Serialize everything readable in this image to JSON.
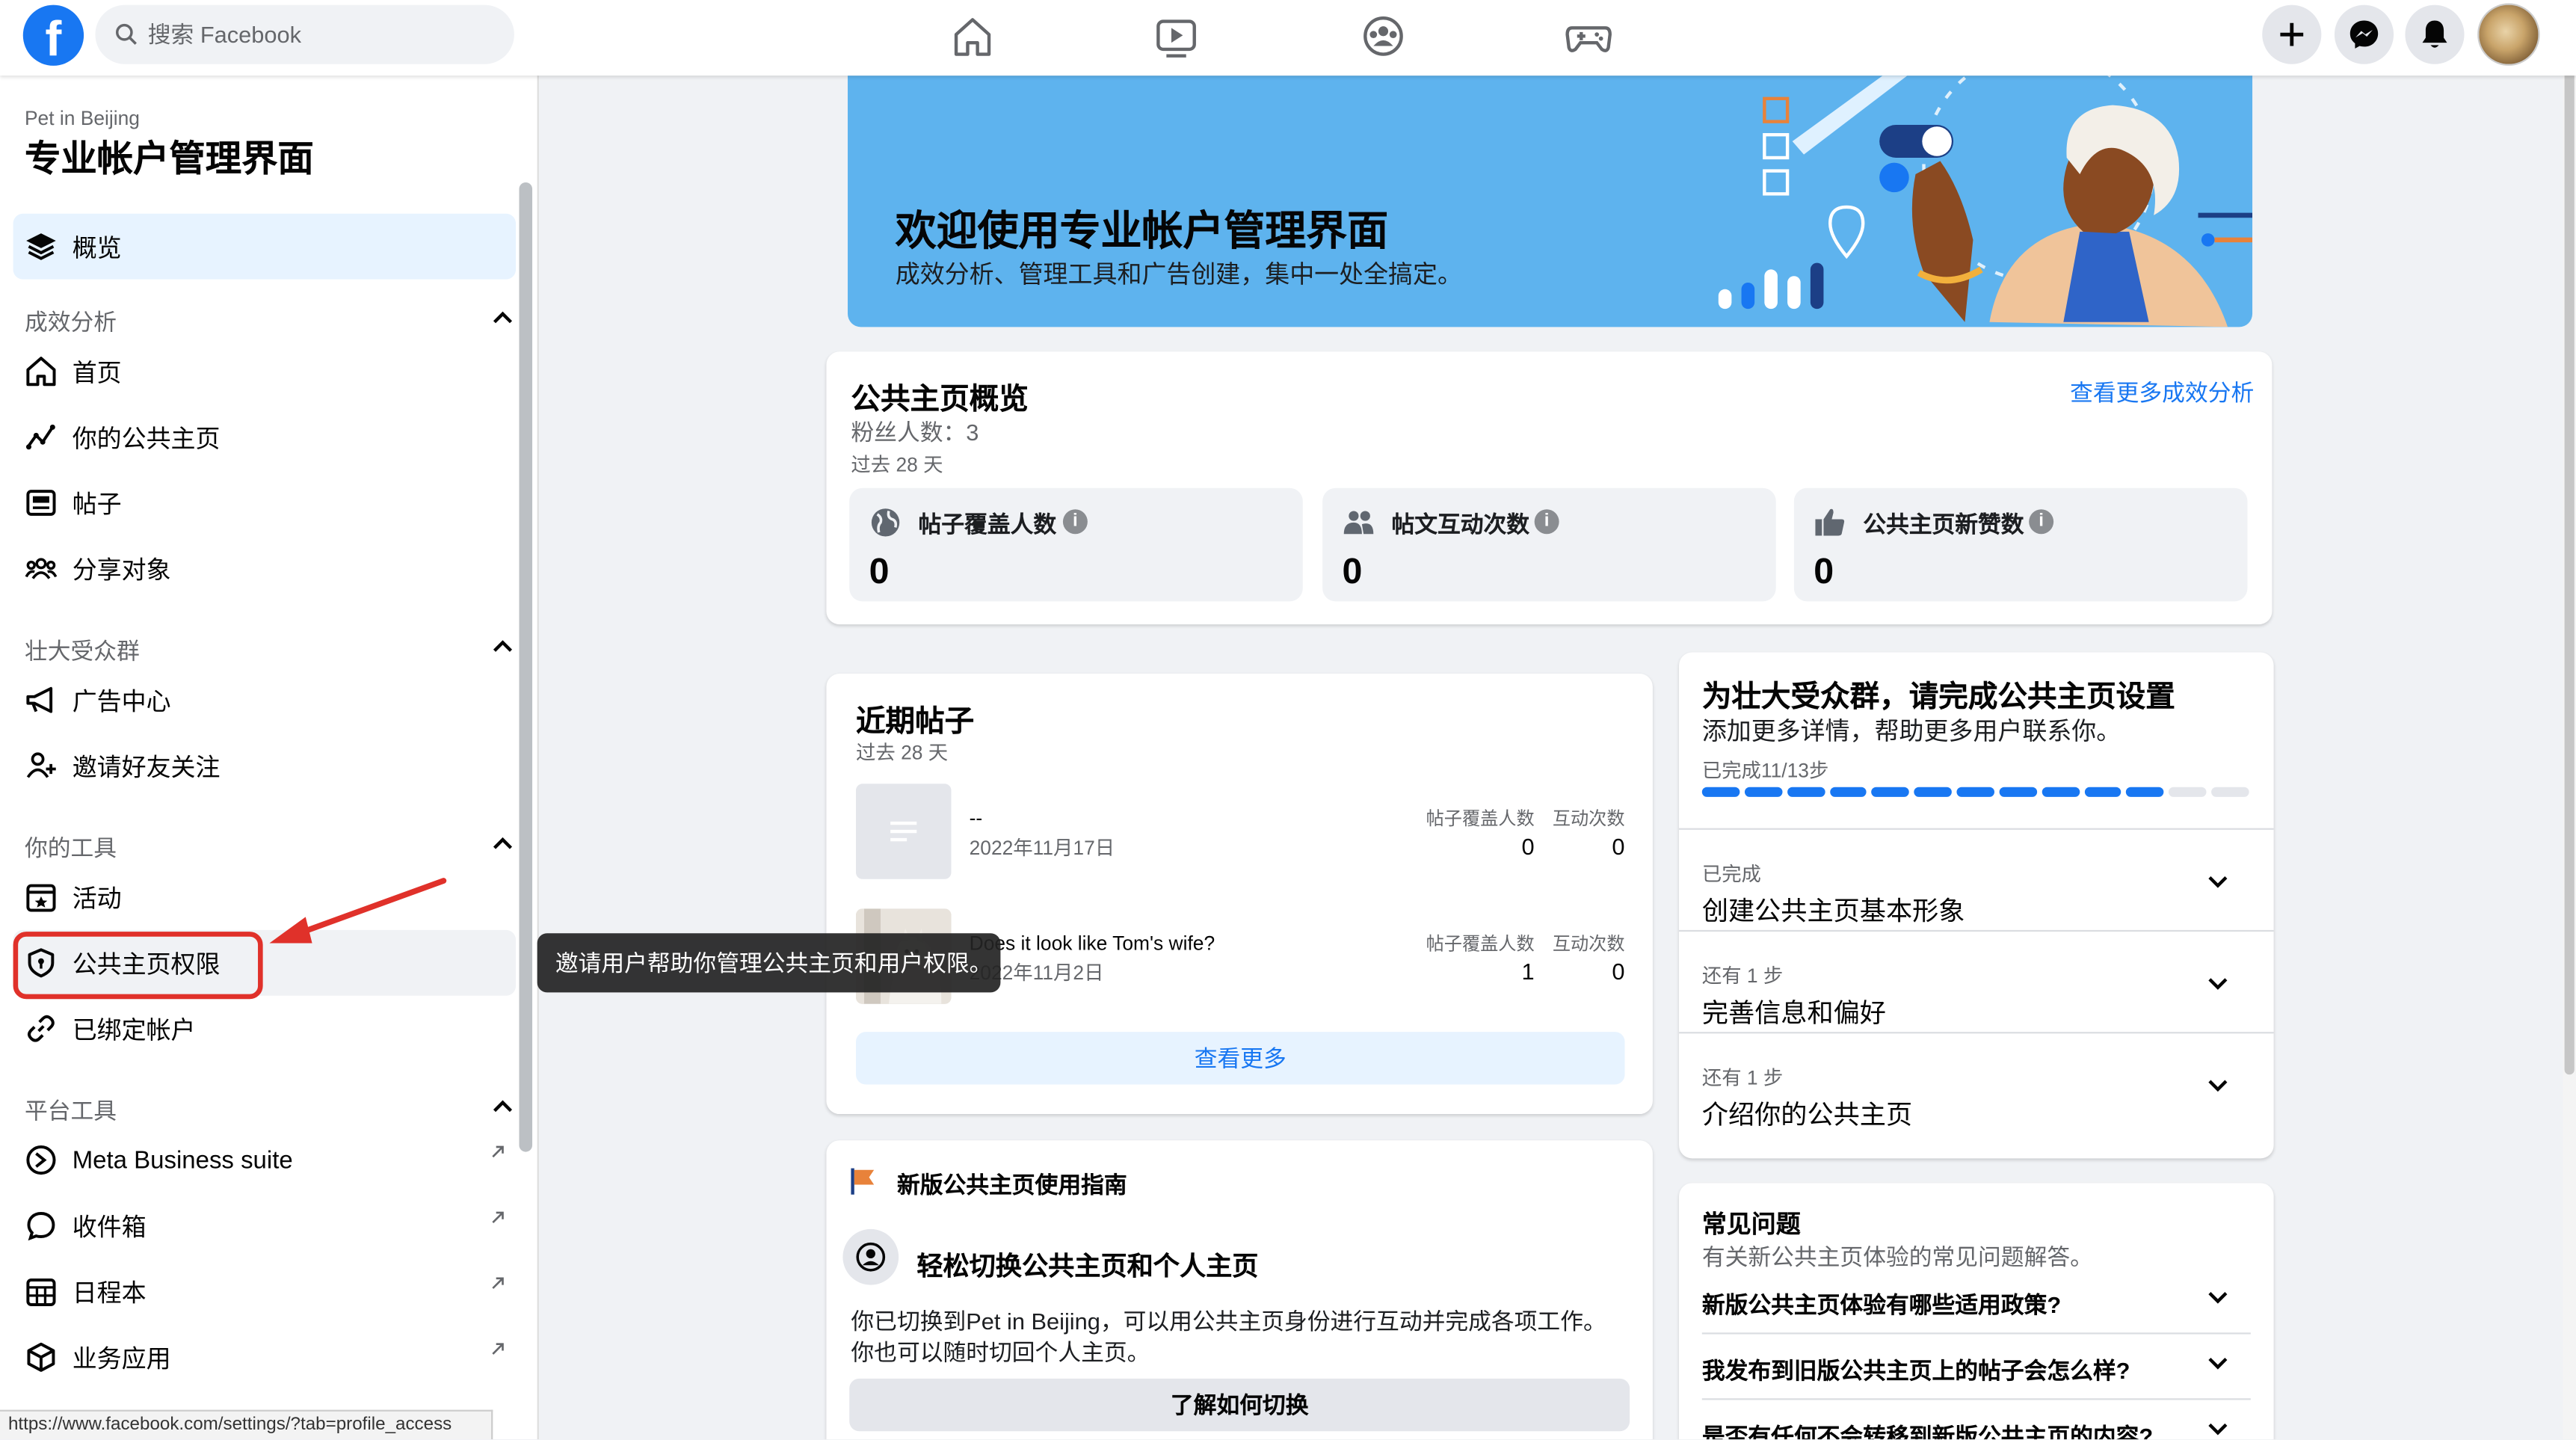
{
  "topbar": {
    "logo": "f",
    "search_placeholder": "搜索 Facebook",
    "nav_icons": [
      "home-icon",
      "watch-icon",
      "groups-icon",
      "gaming-icon"
    ],
    "right_icons": [
      "plus-icon",
      "messenger-icon",
      "bell-icon"
    ]
  },
  "sidebar": {
    "page_name": "Pet in Beijing",
    "title": "专业帐户管理界面",
    "overview": "概览",
    "sections": {
      "insights": "成效分析",
      "grow": "壮大受众群",
      "tools": "你的工具",
      "platform": "平台工具"
    },
    "items": {
      "home": "首页",
      "your_page": "你的公共主页",
      "posts": "帖子",
      "audience": "分享对象",
      "ad_center": "广告中心",
      "invite": "邀请好友关注",
      "events": "活动",
      "page_access": "公共主页权限",
      "linked": "已绑定帐户",
      "business_suite": "Meta Business suite",
      "inbox": "收件箱",
      "calendar": "日程本",
      "biz_apps": "业务应用"
    }
  },
  "tooltip": "邀请用户帮助你管理公共主页和用户权限。",
  "statusbar_url": "https://www.facebook.com/settings/?tab=profile_access",
  "banner": {
    "title": "欢迎使用专业帐户管理界面",
    "subtitle": "成效分析、管理工具和广告创建，集中一处全搞定。"
  },
  "overview_card": {
    "title": "公共主页概览",
    "followers": "粉丝人数：3",
    "period": "过去 28 天",
    "more_link": "查看更多成效分析",
    "stats": [
      {
        "label": "帖子覆盖人数",
        "value": "0"
      },
      {
        "label": "帖文互动次数",
        "value": "0"
      },
      {
        "label": "公共主页新赞数",
        "value": "0"
      }
    ]
  },
  "recent_posts": {
    "title": "近期帖子",
    "period": "过去 28 天",
    "col_reach": "帖子覆盖人数",
    "col_engage": "互动次数",
    "posts": [
      {
        "title": "--",
        "date": "2022年11月17日",
        "reach": "0",
        "engage": "0"
      },
      {
        "title": "Does it look like Tom's wife?",
        "date": "2022年11月2日",
        "reach": "1",
        "engage": "0"
      }
    ],
    "see_more": "查看更多"
  },
  "setup": {
    "title": "为壮大受众群，请完成公共主页设置",
    "subtitle": "添加更多详情，帮助更多用户联系你。",
    "progress_label": "已完成11/13步",
    "progress": {
      "done": 11,
      "total": 13
    },
    "rows": [
      {
        "status": "已完成",
        "task": "创建公共主页基本形象"
      },
      {
        "status": "还有 1 步",
        "task": "完善信息和偏好"
      },
      {
        "status": "还有 1 步",
        "task": "介绍你的公共主页"
      }
    ]
  },
  "guide": {
    "title": "新版公共主页使用指南",
    "heading": "轻松切换公共主页和个人主页",
    "body": "你已切换到Pet in Beijing，可以用公共主页身份进行互动并完成各项工作。你也可以随时切回个人主页。",
    "button": "了解如何切换"
  },
  "faq": {
    "title": "常见问题",
    "subtitle": "有关新公共主页体验的常见问题解答。",
    "questions": [
      "新版公共主页体验有哪些适用政策?",
      "我发布到旧版公共主页上的帖子会怎么样?",
      "是否有任何不会转移到新版公共主页的内容?"
    ]
  },
  "colors": {
    "brand": "#1877f2",
    "highlight": "#e0312a",
    "banner": "#5eb3ee"
  }
}
